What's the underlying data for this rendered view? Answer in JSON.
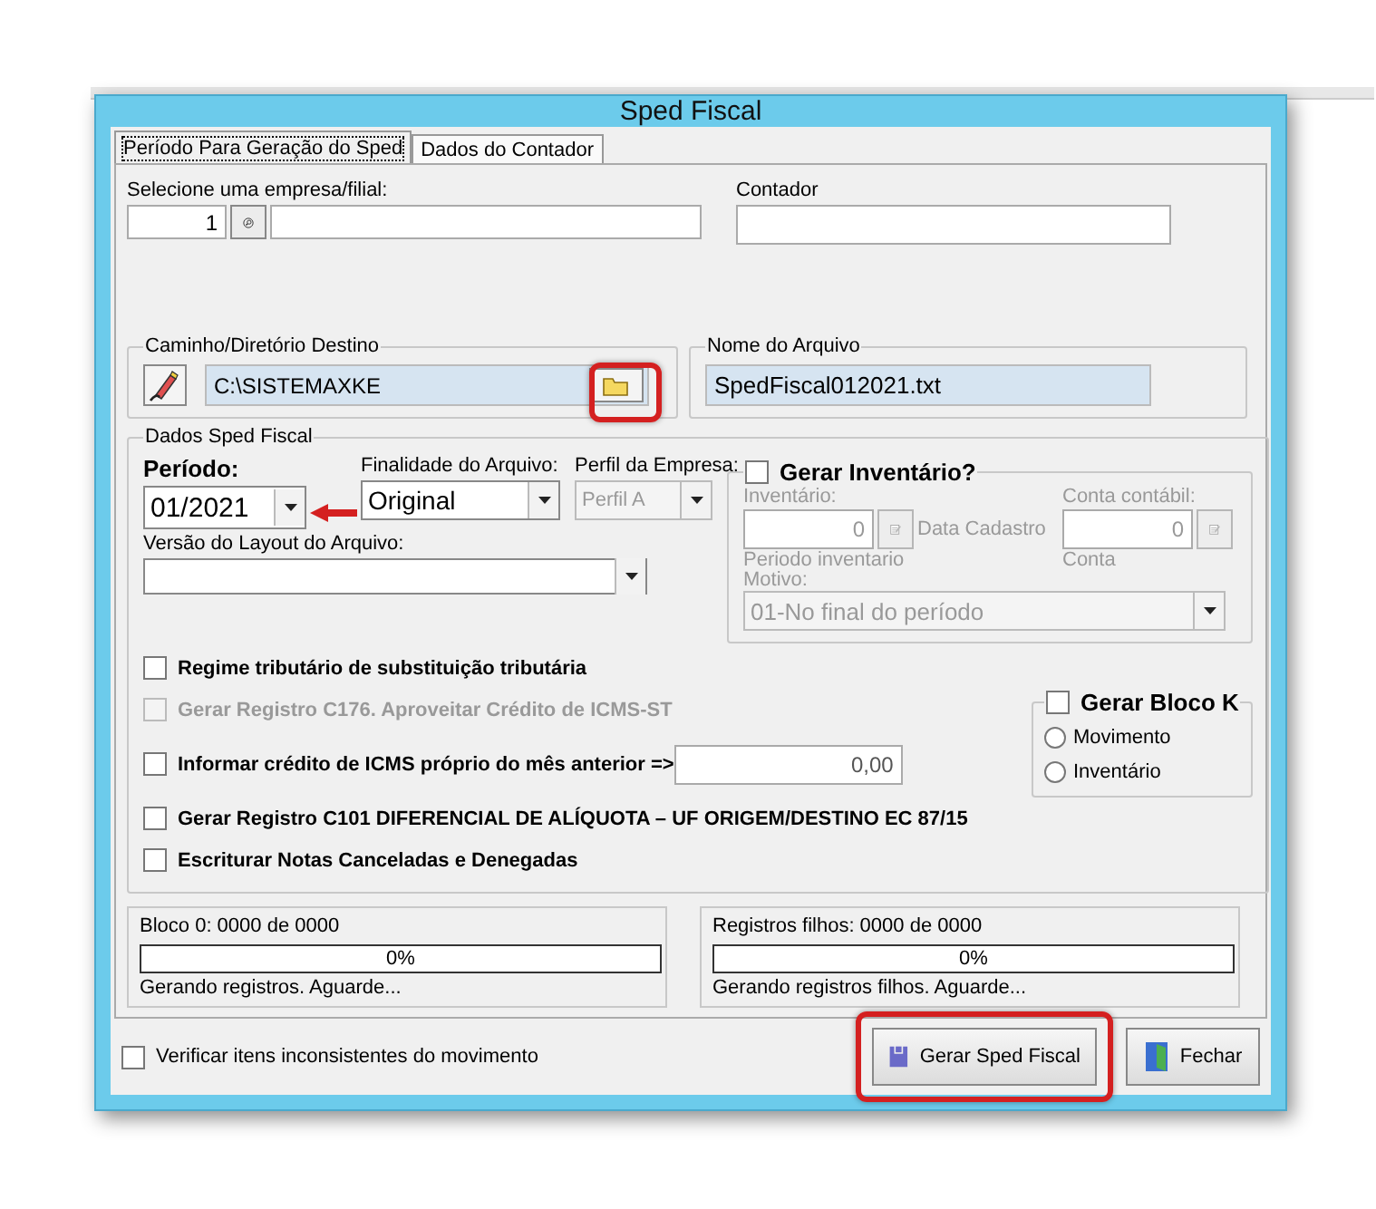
{
  "window": {
    "title": "Sped Fiscal"
  },
  "tabs": [
    {
      "label": "Período Para Geração do Sped",
      "selected": true
    },
    {
      "label": "Dados do Contador",
      "selected": false
    }
  ],
  "empresa": {
    "label": "Selecione uma empresa/filial:",
    "code": "1"
  },
  "contador": {
    "label": "Contador"
  },
  "destino": {
    "legend": "Caminho/Diretório Destino",
    "path": "C:\\SISTEMAXKE",
    "highlighted": true
  },
  "arquivo": {
    "legend": "Nome do Arquivo",
    "value": "SpedFiscal012021.txt"
  },
  "sped": {
    "legend": "Dados Sped Fiscal",
    "periodo": {
      "label": "Período:",
      "value": "01/2021",
      "annotated": true
    },
    "finalidade": {
      "label": "Finalidade do Arquivo:",
      "value": "Original"
    },
    "perfil": {
      "label": "Perfil da Empresa:",
      "value": "Perfil A",
      "disabled": true
    },
    "versao": {
      "label": "Versão do Layout do Arquivo:"
    },
    "inventario": {
      "label": "Gerar Inventário?",
      "checked": false,
      "inventario_label": "Inventário:",
      "inventario_value": "0",
      "data_label": "Data Cadastro",
      "conta_label": "Conta contábil:",
      "conta_value": "0",
      "conta_caption": "Conta",
      "periodo_label": "Periodo inventario",
      "motivo_label": "Motivo:",
      "motivo": "01-No final do período"
    },
    "options": [
      {
        "label": "Regime tributário de substituição tributária",
        "checked": false,
        "disabled": false
      },
      {
        "label": "Gerar Registro C176. Aproveitar Crédito de ICMS-ST",
        "checked": false,
        "disabled": true
      },
      {
        "label": "Informar crédito de ICMS próprio do mês anterior =>",
        "checked": false,
        "disabled": false,
        "value": "0,00"
      },
      {
        "label": "Gerar Registro C101 DIFERENCIAL DE ALÍQUOTA – UF ORIGEM/DESTINO EC 87/15",
        "checked": false,
        "disabled": false
      },
      {
        "label": "Escriturar Notas Canceladas e Denegadas",
        "checked": false,
        "disabled": false
      }
    ],
    "bloco_k": {
      "label": "Gerar Bloco K",
      "checked": false,
      "options": [
        {
          "label": "Movimento",
          "selected": false
        },
        {
          "label": "Inventário",
          "selected": false
        }
      ]
    }
  },
  "progress": [
    {
      "label": "Bloco 0: 0000 de 0000",
      "level": 0,
      "percent": "0%",
      "status": "Gerando registros. Aguarde..."
    },
    {
      "label": "Registros filhos: 0000 de 0000",
      "level": 0,
      "percent": "0%",
      "status": "Gerando registros filhos. Aguarde..."
    }
  ],
  "verificar": {
    "label": "Verificar itens inconsistentes do movimento",
    "checked": false
  },
  "buttons": [
    {
      "label": "Gerar Sped Fiscal",
      "kind": "generate",
      "highlighted": true
    },
    {
      "label": "Fechar",
      "kind": "close",
      "highlighted": false
    }
  ]
}
